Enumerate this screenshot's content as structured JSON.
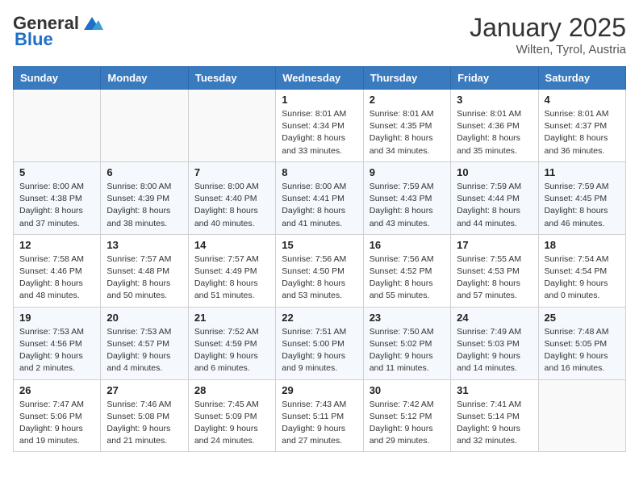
{
  "logo": {
    "general": "General",
    "blue": "Blue"
  },
  "title": "January 2025",
  "location": "Wilten, Tyrol, Austria",
  "weekdays": [
    "Sunday",
    "Monday",
    "Tuesday",
    "Wednesday",
    "Thursday",
    "Friday",
    "Saturday"
  ],
  "weeks": [
    [
      {
        "day": "",
        "sunrise": "",
        "sunset": "",
        "daylight": ""
      },
      {
        "day": "",
        "sunrise": "",
        "sunset": "",
        "daylight": ""
      },
      {
        "day": "",
        "sunrise": "",
        "sunset": "",
        "daylight": ""
      },
      {
        "day": "1",
        "sunrise": "Sunrise: 8:01 AM",
        "sunset": "Sunset: 4:34 PM",
        "daylight": "Daylight: 8 hours and 33 minutes."
      },
      {
        "day": "2",
        "sunrise": "Sunrise: 8:01 AM",
        "sunset": "Sunset: 4:35 PM",
        "daylight": "Daylight: 8 hours and 34 minutes."
      },
      {
        "day": "3",
        "sunrise": "Sunrise: 8:01 AM",
        "sunset": "Sunset: 4:36 PM",
        "daylight": "Daylight: 8 hours and 35 minutes."
      },
      {
        "day": "4",
        "sunrise": "Sunrise: 8:01 AM",
        "sunset": "Sunset: 4:37 PM",
        "daylight": "Daylight: 8 hours and 36 minutes."
      }
    ],
    [
      {
        "day": "5",
        "sunrise": "Sunrise: 8:00 AM",
        "sunset": "Sunset: 4:38 PM",
        "daylight": "Daylight: 8 hours and 37 minutes."
      },
      {
        "day": "6",
        "sunrise": "Sunrise: 8:00 AM",
        "sunset": "Sunset: 4:39 PM",
        "daylight": "Daylight: 8 hours and 38 minutes."
      },
      {
        "day": "7",
        "sunrise": "Sunrise: 8:00 AM",
        "sunset": "Sunset: 4:40 PM",
        "daylight": "Daylight: 8 hours and 40 minutes."
      },
      {
        "day": "8",
        "sunrise": "Sunrise: 8:00 AM",
        "sunset": "Sunset: 4:41 PM",
        "daylight": "Daylight: 8 hours and 41 minutes."
      },
      {
        "day": "9",
        "sunrise": "Sunrise: 7:59 AM",
        "sunset": "Sunset: 4:43 PM",
        "daylight": "Daylight: 8 hours and 43 minutes."
      },
      {
        "day": "10",
        "sunrise": "Sunrise: 7:59 AM",
        "sunset": "Sunset: 4:44 PM",
        "daylight": "Daylight: 8 hours and 44 minutes."
      },
      {
        "day": "11",
        "sunrise": "Sunrise: 7:59 AM",
        "sunset": "Sunset: 4:45 PM",
        "daylight": "Daylight: 8 hours and 46 minutes."
      }
    ],
    [
      {
        "day": "12",
        "sunrise": "Sunrise: 7:58 AM",
        "sunset": "Sunset: 4:46 PM",
        "daylight": "Daylight: 8 hours and 48 minutes."
      },
      {
        "day": "13",
        "sunrise": "Sunrise: 7:57 AM",
        "sunset": "Sunset: 4:48 PM",
        "daylight": "Daylight: 8 hours and 50 minutes."
      },
      {
        "day": "14",
        "sunrise": "Sunrise: 7:57 AM",
        "sunset": "Sunset: 4:49 PM",
        "daylight": "Daylight: 8 hours and 51 minutes."
      },
      {
        "day": "15",
        "sunrise": "Sunrise: 7:56 AM",
        "sunset": "Sunset: 4:50 PM",
        "daylight": "Daylight: 8 hours and 53 minutes."
      },
      {
        "day": "16",
        "sunrise": "Sunrise: 7:56 AM",
        "sunset": "Sunset: 4:52 PM",
        "daylight": "Daylight: 8 hours and 55 minutes."
      },
      {
        "day": "17",
        "sunrise": "Sunrise: 7:55 AM",
        "sunset": "Sunset: 4:53 PM",
        "daylight": "Daylight: 8 hours and 57 minutes."
      },
      {
        "day": "18",
        "sunrise": "Sunrise: 7:54 AM",
        "sunset": "Sunset: 4:54 PM",
        "daylight": "Daylight: 9 hours and 0 minutes."
      }
    ],
    [
      {
        "day": "19",
        "sunrise": "Sunrise: 7:53 AM",
        "sunset": "Sunset: 4:56 PM",
        "daylight": "Daylight: 9 hours and 2 minutes."
      },
      {
        "day": "20",
        "sunrise": "Sunrise: 7:53 AM",
        "sunset": "Sunset: 4:57 PM",
        "daylight": "Daylight: 9 hours and 4 minutes."
      },
      {
        "day": "21",
        "sunrise": "Sunrise: 7:52 AM",
        "sunset": "Sunset: 4:59 PM",
        "daylight": "Daylight: 9 hours and 6 minutes."
      },
      {
        "day": "22",
        "sunrise": "Sunrise: 7:51 AM",
        "sunset": "Sunset: 5:00 PM",
        "daylight": "Daylight: 9 hours and 9 minutes."
      },
      {
        "day": "23",
        "sunrise": "Sunrise: 7:50 AM",
        "sunset": "Sunset: 5:02 PM",
        "daylight": "Daylight: 9 hours and 11 minutes."
      },
      {
        "day": "24",
        "sunrise": "Sunrise: 7:49 AM",
        "sunset": "Sunset: 5:03 PM",
        "daylight": "Daylight: 9 hours and 14 minutes."
      },
      {
        "day": "25",
        "sunrise": "Sunrise: 7:48 AM",
        "sunset": "Sunset: 5:05 PM",
        "daylight": "Daylight: 9 hours and 16 minutes."
      }
    ],
    [
      {
        "day": "26",
        "sunrise": "Sunrise: 7:47 AM",
        "sunset": "Sunset: 5:06 PM",
        "daylight": "Daylight: 9 hours and 19 minutes."
      },
      {
        "day": "27",
        "sunrise": "Sunrise: 7:46 AM",
        "sunset": "Sunset: 5:08 PM",
        "daylight": "Daylight: 9 hours and 21 minutes."
      },
      {
        "day": "28",
        "sunrise": "Sunrise: 7:45 AM",
        "sunset": "Sunset: 5:09 PM",
        "daylight": "Daylight: 9 hours and 24 minutes."
      },
      {
        "day": "29",
        "sunrise": "Sunrise: 7:43 AM",
        "sunset": "Sunset: 5:11 PM",
        "daylight": "Daylight: 9 hours and 27 minutes."
      },
      {
        "day": "30",
        "sunrise": "Sunrise: 7:42 AM",
        "sunset": "Sunset: 5:12 PM",
        "daylight": "Daylight: 9 hours and 29 minutes."
      },
      {
        "day": "31",
        "sunrise": "Sunrise: 7:41 AM",
        "sunset": "Sunset: 5:14 PM",
        "daylight": "Daylight: 9 hours and 32 minutes."
      },
      {
        "day": "",
        "sunrise": "",
        "sunset": "",
        "daylight": ""
      }
    ]
  ]
}
